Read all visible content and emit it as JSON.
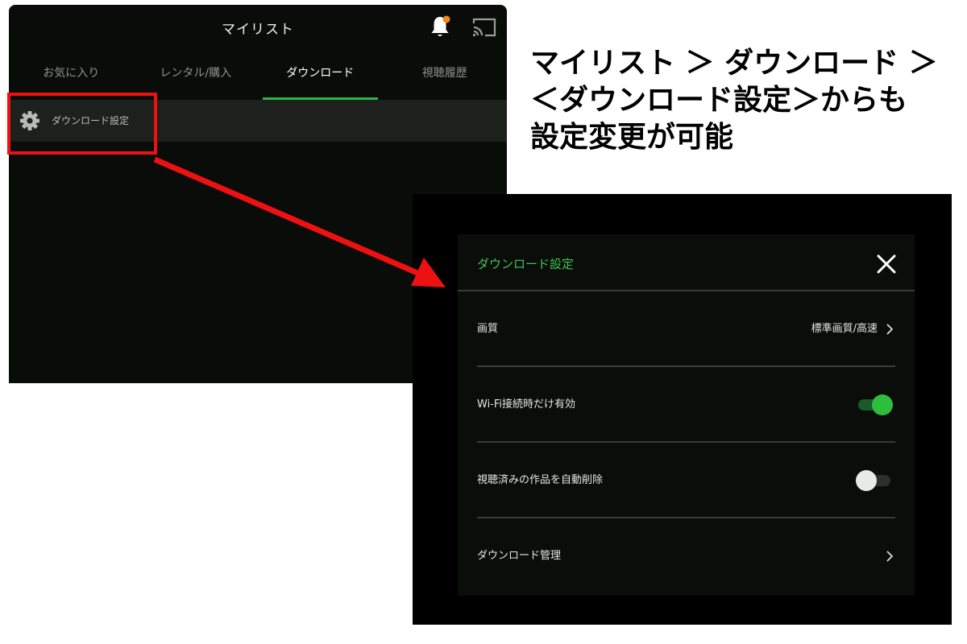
{
  "mylist": {
    "title": "マイリスト",
    "tabs": [
      {
        "label": "お気に入り",
        "active": false
      },
      {
        "label": "レンタル/購入",
        "active": false
      },
      {
        "label": "ダウンロード",
        "active": true
      },
      {
        "label": "視聴履歴",
        "active": false
      }
    ],
    "settings_row_label": "ダウンロード設定",
    "notification_dot_color": "#f08a1e",
    "accent_color": "#2bb54d",
    "icons": {
      "bell": "bell-icon",
      "cast": "cast-icon",
      "gear": "gear-icon"
    }
  },
  "annotation": {
    "highlight_color": "#ee1111",
    "callout_lines": [
      "マイリスト ＞ ダウンロード ＞",
      "＜ダウンロード設定＞からも",
      "設定変更が可能"
    ]
  },
  "dialog": {
    "title": "ダウンロード設定",
    "title_color": "#3ec653",
    "rows": [
      {
        "label": "画質",
        "value": "標準画質/高速",
        "control": "chevron"
      },
      {
        "label": "Wi-Fi接続時だけ有効",
        "control": "toggle",
        "on": true
      },
      {
        "label": "視聴済みの作品を自動削除",
        "control": "toggle",
        "on": false
      },
      {
        "label": "ダウンロード管理",
        "control": "chevron"
      }
    ],
    "icons": {
      "close": "close-icon",
      "chevron": "chevron-right-icon"
    }
  }
}
